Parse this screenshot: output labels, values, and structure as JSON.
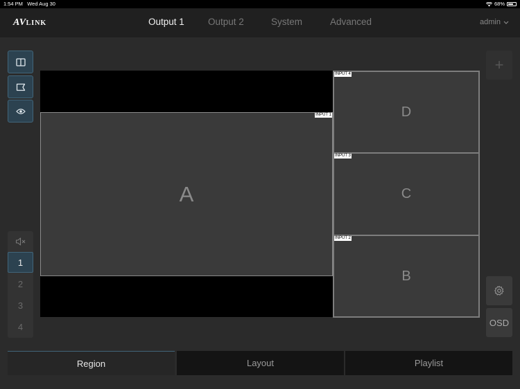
{
  "status_bar": {
    "time": "1:54 PM",
    "date": "Wed Aug 30",
    "battery": "68%",
    "battery_level": 0.68
  },
  "app": {
    "logo_main": "AV",
    "logo_small": "LINK",
    "tabs": [
      {
        "label": "Output 1",
        "active": true
      },
      {
        "label": "Output 2",
        "active": false
      },
      {
        "label": "System",
        "active": false
      },
      {
        "label": "Advanced",
        "active": false
      }
    ],
    "user": "admin"
  },
  "left_toolbar": [
    "split-layout-icon",
    "flag-icon",
    "eye-icon"
  ],
  "plus_label": "+",
  "regions": [
    {
      "letter": "A",
      "input": "INPUT 1"
    },
    {
      "letter": "D",
      "input": "INPUT 4"
    },
    {
      "letter": "C",
      "input": "INPUT 3"
    },
    {
      "letter": "B",
      "input": "INPUT 2"
    }
  ],
  "audio": {
    "mute_icon": "speaker-mute-icon",
    "channels": [
      "1",
      "2",
      "3",
      "4"
    ],
    "selected": "1"
  },
  "right_toolbar": {
    "settings_icon": "gear-icon",
    "osd_label": "OSD"
  },
  "bottom_tabs": [
    {
      "label": "Region",
      "active": true
    },
    {
      "label": "Layout",
      "active": false
    },
    {
      "label": "Playlist",
      "active": false
    }
  ],
  "colors": {
    "accent": "#41657a",
    "background": "#2b2b2b",
    "region_fill": "#3a3a3a"
  }
}
